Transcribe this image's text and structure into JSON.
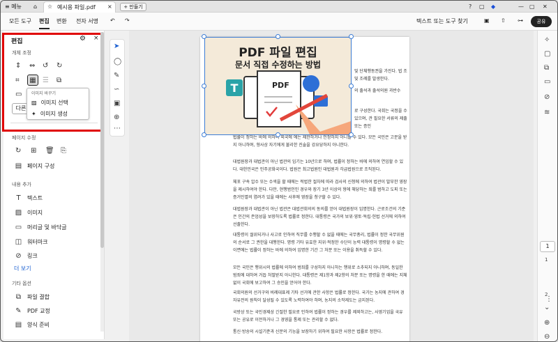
{
  "titlebar": {
    "menu": "메뉴",
    "tab_title": "예시용 파일.pdf",
    "new_tab": "만들기"
  },
  "menubar": {
    "items": [
      "모든 도구",
      "편집",
      "변환",
      "전자 서명"
    ],
    "search": "텍스트 또는 도구 찾기",
    "share": "공유"
  },
  "panel": {
    "title": "편집",
    "section_image": "개체 조정",
    "tooltip_title": "이미지 바꾸기",
    "tooltip_options": [
      "이미지 선택",
      "이미지 생성"
    ],
    "more_button": "다른",
    "section_pages": "페이지 수정",
    "page_config": "페이지 구성",
    "section_content": "내용 추가",
    "content_items": [
      "텍스트",
      "이미지",
      "머리글 및 바닥글",
      "워터마크",
      "링크"
    ],
    "more_link": "더 보기",
    "section_other": "기타 옵션",
    "other_items": [
      "파일 결합",
      "PDF 교정",
      "양식 준비"
    ]
  },
  "image": {
    "title1": "PDF 파일 편집",
    "title2": "문서 직접 수정하는 방법",
    "pdf_label": "PDF"
  },
  "document": {
    "paragraphs": [
      "및 단체행동권을 가진다. 법 조 및 조례를 발생한다.",
      "의 출석과 출석의원 과반수",
      "로 구성한다. 국회는 국정을 수 있으며, 관 필요한 서류의 제출 또는 증인",
      "법률이 정하는 바에 의하여 외국에 에는 제한하거나 인정하지 아니할 수 있다. 모든 국민은 고문을 받지 아니하며, 형사상 자기에게 불리한 진술을 강요당하지 아니한다.",
      "대법원장과 대법관이 아닌 법관의 임기는 10년으로 하며, 법률이 정하는 바에 의하여 연임할 수 있다. 대한민국은 민주공화국이다. 법원은 최고법원인 대법원과 각급법원으로 조직된다.",
      "체포 구속 압수 또는 수색을 할 때에는 적법한 절차에 따라 검사의 신청에 의하여 법관이 발부한 영장을 제시하여야 한다. 다만, 현행범인인 경우와 장기 3년 이상의 형에 해당하는 죄를 범하고 도피 또는 증거인멸의 염려가 있을 때에는 사후에 영장을 청구할 수 있다.",
      "대법원장과 대법관이 아닌 법관은 대법관회의의 동의를 얻어 대법원장이 임명한다. 근로조건의 기준은 인간의 존엄성을 보장하도록 법률로 정한다. 대통령은 국가의 보위·영토·독립·헌법 선거에 의하여 선출한다.",
      "대통령이 궐위되거나 사고로 인하여 직무를 수행할 수 없을 때에는 국무총리, 법률이 정한 국무위원의 순서로 그 권한을 대행한다. 명령 기타 유효한 지위·적정한 수단이 능력 대통령이 명령할 수 없는 이면에는 법률이 정하는 바에 의하여 임명한 기간 그 처분 또는 이용을 취득할 수 있다.",
      "모든 국민은 행위시의 법률에 의하여 범죄를 구성하지 아니하는 행위로 소추되지 아니하며, 동일한 범죄에 대하여 거듭 처벌받지 아니한다. 대통령은 제1항과 제2항의 처분 또는 명령을 한 때에는 지체없이 국회에 보고하여 그 승인을 얻어야 한다.",
      "국회의원의 선거구와 비례대표제 기타 선거에 관한 사항은 법률로 정한다. 국가는 농지에 관하여 경자유전의 원칙이 달성될 수 있도록 노력하여야 하며, 농지의 소작제도는 금지된다.",
      "국방상 또는 국민경제상 긴절한 필요로 인하여 법률이 정하는 경우를 제외하고는, 사영기업을 국유 또는 공유로 이전하거나 그 경영을 통제 또는 관리할 수 없다.",
      "통신·방송의 시설기준과 신문의 기능을 보장하기 위하여 필요한 사항은 법률로 정한다."
    ]
  },
  "pager": {
    "current": "1",
    "total": "2"
  },
  "colors": {
    "highlight": "#e00000",
    "accent": "#3a7bd5"
  }
}
